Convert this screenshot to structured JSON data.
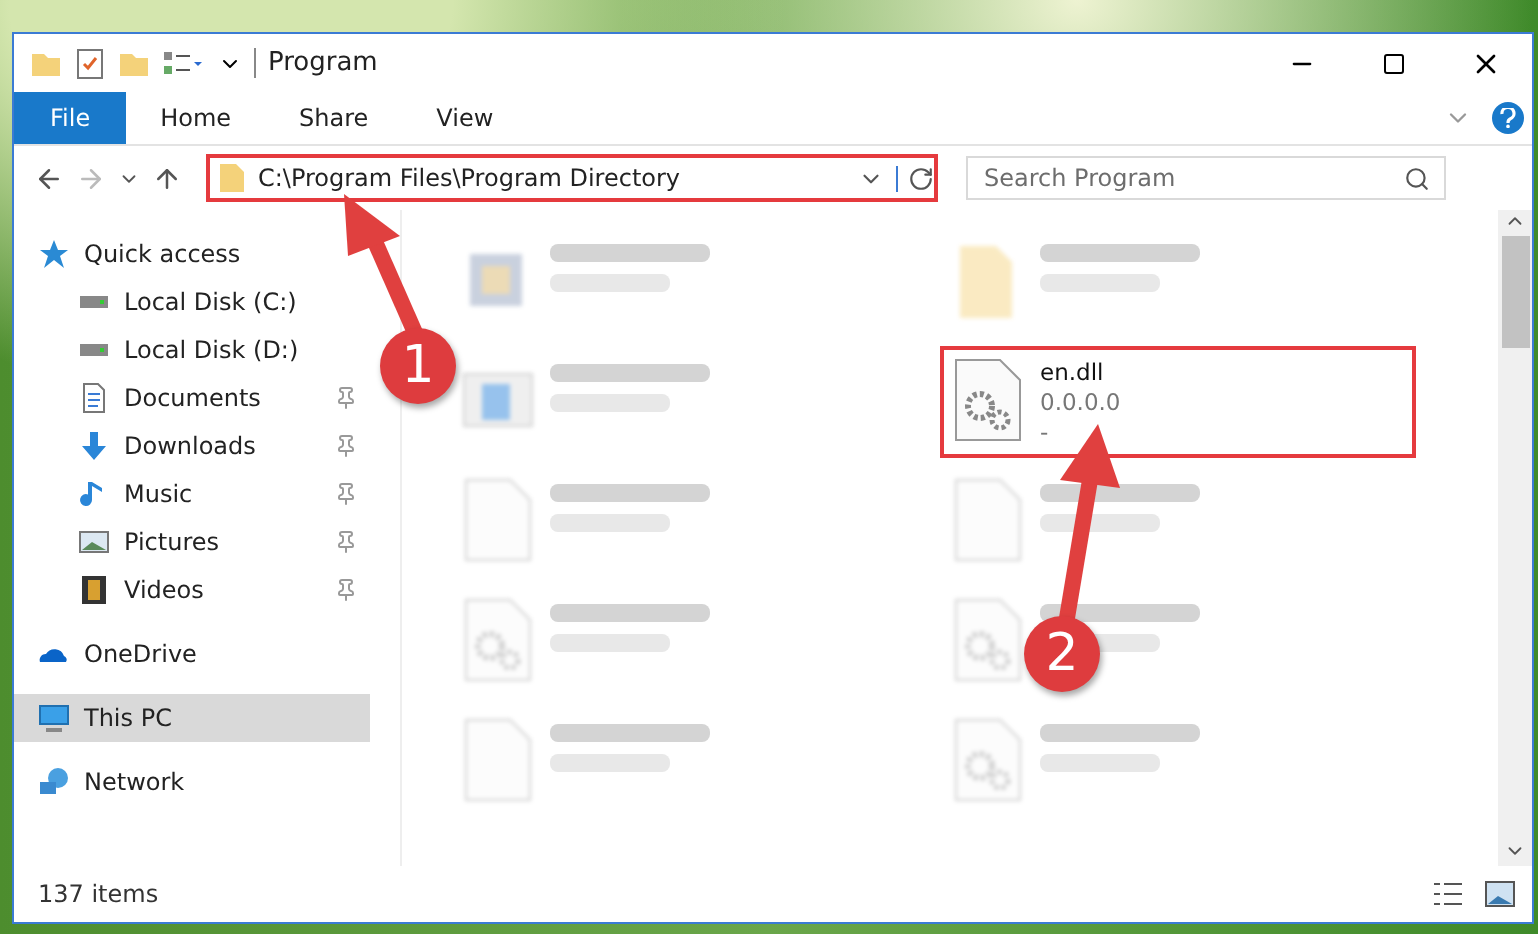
{
  "window": {
    "title": "Program"
  },
  "ribbon_tabs": [
    {
      "label": "File",
      "kind": "file",
      "selected": true
    },
    {
      "label": "Home",
      "kind": "tab",
      "selected": false
    },
    {
      "label": "Share",
      "kind": "tab",
      "selected": false
    },
    {
      "label": "View",
      "kind": "tab",
      "selected": false
    }
  ],
  "address_bar": {
    "path": "C:\\Program Files\\Program Directory",
    "highlighted": true
  },
  "search": {
    "placeholder": "Search Program"
  },
  "navigation": [
    {
      "label": "Quick access",
      "kind": "star",
      "selected": false,
      "pinned": false,
      "children": [
        {
          "label": "Local Disk (C:)",
          "kind": "disk",
          "selected": false,
          "pinned": false
        },
        {
          "label": "Local Disk (D:)",
          "kind": "disk",
          "selected": false,
          "pinned": false
        },
        {
          "label": "Documents",
          "kind": "document",
          "selected": false,
          "pinned": true
        },
        {
          "label": "Downloads",
          "kind": "download",
          "selected": false,
          "pinned": true
        },
        {
          "label": "Music",
          "kind": "music",
          "selected": false,
          "pinned": true
        },
        {
          "label": "Pictures",
          "kind": "picture",
          "selected": false,
          "pinned": true
        },
        {
          "label": "Videos",
          "kind": "video",
          "selected": false,
          "pinned": true
        }
      ]
    },
    {
      "label": "OneDrive",
      "kind": "cloud",
      "selected": false,
      "pinned": false
    },
    {
      "label": "This PC",
      "kind": "pc",
      "selected": true,
      "pinned": false
    },
    {
      "label": "Network",
      "kind": "network",
      "selected": false,
      "pinned": false
    }
  ],
  "files": [
    {
      "kind": "app",
      "blurred": true,
      "highlighted": false
    },
    {
      "kind": "folder",
      "blurred": true,
      "highlighted": false
    },
    {
      "kind": "window",
      "blurred": true,
      "highlighted": false
    },
    {
      "name": "en.dll",
      "kind": "dll",
      "lines": [
        "0.0.0.0",
        "-"
      ],
      "blurred": false,
      "highlighted": true
    },
    {
      "kind": "blank",
      "blurred": true,
      "highlighted": false
    },
    {
      "kind": "blank",
      "blurred": true,
      "highlighted": false
    },
    {
      "kind": "dll",
      "blurred": true,
      "highlighted": false
    },
    {
      "kind": "dll",
      "blurred": true,
      "highlighted": false
    },
    {
      "kind": "blank",
      "blurred": true,
      "highlighted": false
    },
    {
      "kind": "dll",
      "blurred": true,
      "highlighted": false
    }
  ],
  "status_bar": {
    "item_count": "137 items"
  },
  "annotations": [
    {
      "number": "1"
    },
    {
      "number": "2"
    }
  ]
}
